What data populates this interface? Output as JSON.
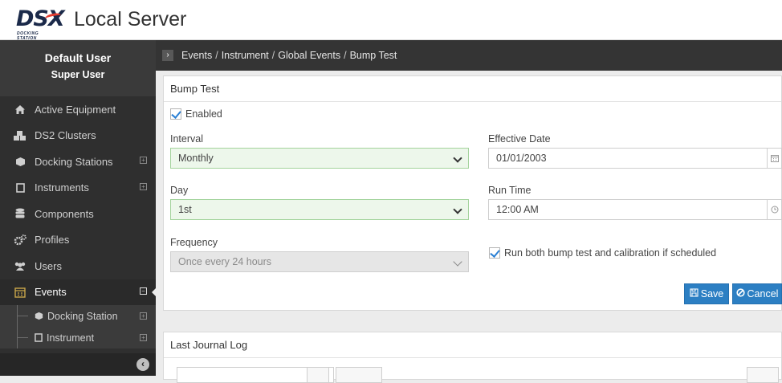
{
  "app": {
    "logo_text": "DSX",
    "logo_sub": "DOCKING STATION",
    "title": "Local Server"
  },
  "user": {
    "name": "Default User",
    "role": "Super User"
  },
  "sidebar": {
    "items": [
      {
        "label": "Active Equipment",
        "icon": "home-icon"
      },
      {
        "label": "DS2 Clusters",
        "icon": "cubes-icon"
      },
      {
        "label": "Docking Stations",
        "icon": "cube-icon",
        "expandable": true
      },
      {
        "label": "Instruments",
        "icon": "square-icon",
        "expandable": true
      },
      {
        "label": "Components",
        "icon": "database-icon"
      },
      {
        "label": "Profiles",
        "icon": "cogs-icon"
      },
      {
        "label": "Users",
        "icon": "users-icon"
      },
      {
        "label": "Events",
        "icon": "calendar-icon",
        "expandable": true,
        "active": true
      }
    ],
    "sub_items": [
      {
        "label": "Docking Station",
        "icon": "cube-icon"
      },
      {
        "label": "Instrument",
        "icon": "square-icon"
      }
    ]
  },
  "breadcrumb": {
    "items": [
      "Events",
      "Instrument",
      "Global Events",
      "Bump Test"
    ]
  },
  "form": {
    "title": "Bump Test",
    "enabled_label": "Enabled",
    "enabled": true,
    "interval_label": "Interval",
    "interval_value": "Monthly",
    "effective_date_label": "Effective Date",
    "effective_date_value": "01/01/2003",
    "day_label": "Day",
    "day_value": "1st",
    "run_time_label": "Run Time",
    "run_time_value": "12:00 AM",
    "frequency_label": "Frequency",
    "frequency_value": "Once every 24 hours",
    "run_both_label": "Run both bump test and calibration if scheduled",
    "run_both": true,
    "save_label": "Save",
    "cancel_label": "Cancel"
  },
  "journal": {
    "title": "Last Journal Log"
  },
  "colors": {
    "accent": "#2c7fc3",
    "sidebar_bg": "#2f2f2f",
    "select_valid_bg": "#edf7eb"
  }
}
